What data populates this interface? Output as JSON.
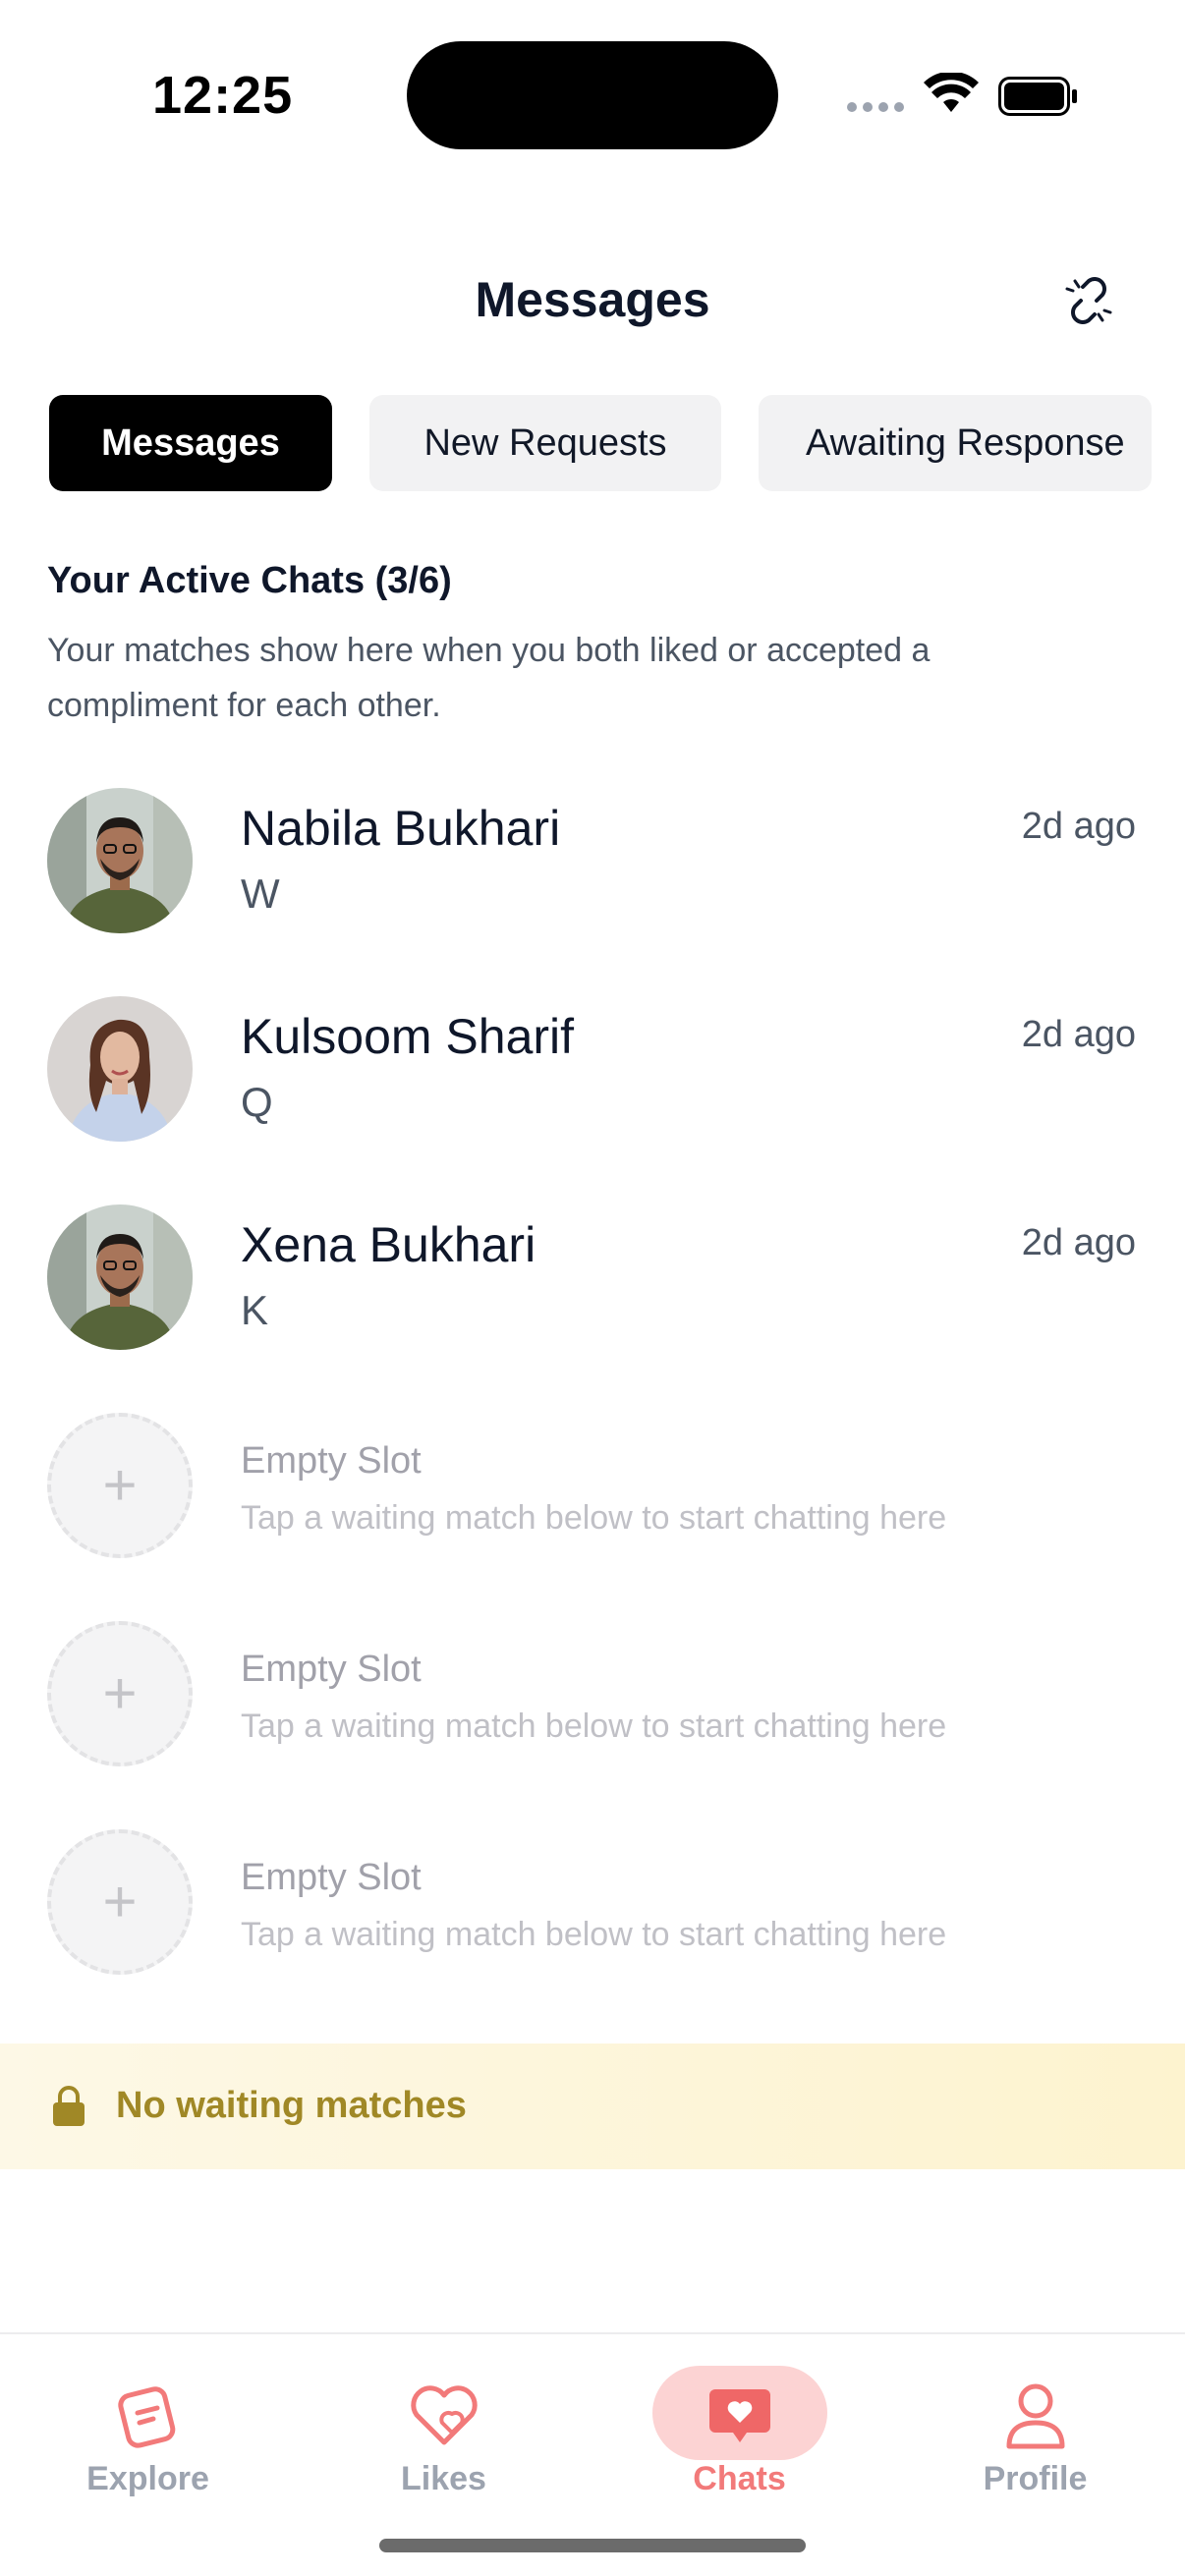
{
  "status_bar": {
    "time": "12:25"
  },
  "header": {
    "title": "Messages"
  },
  "tabs": [
    {
      "label": "Messages",
      "active": true
    },
    {
      "label": "New Requests",
      "active": false
    },
    {
      "label": "Awaiting Response",
      "active": false
    }
  ],
  "section": {
    "title": "Your Active Chats (3/6)",
    "description": "Your matches show here when you both liked or accepted a compliment for each other."
  },
  "chats": [
    {
      "name": "Nabila Bukhari",
      "message": "W",
      "time": "2d ago",
      "avatar": "man-photo"
    },
    {
      "name": "Kulsoom Sharif",
      "message": "Q",
      "time": "2d ago",
      "avatar": "woman-photo"
    },
    {
      "name": "Xena Bukhari",
      "message": "K",
      "time": "2d ago",
      "avatar": "man-photo"
    }
  ],
  "empty_slots": [
    {
      "title": "Empty Slot",
      "subtitle": "Tap a waiting match below to start chatting here"
    },
    {
      "title": "Empty Slot",
      "subtitle": "Tap a waiting match below to start chatting here"
    },
    {
      "title": "Empty Slot",
      "subtitle": "Tap a waiting match below to start chatting here"
    }
  ],
  "waiting_banner": {
    "text": "No waiting matches",
    "icon": "lock-icon"
  },
  "bottom_nav": [
    {
      "label": "Explore",
      "icon": "explore-icon",
      "active": false
    },
    {
      "label": "Likes",
      "icon": "likes-icon",
      "active": false
    },
    {
      "label": "Chats",
      "icon": "chats-icon",
      "active": true
    },
    {
      "label": "Profile",
      "icon": "profile-icon",
      "active": false
    }
  ],
  "colors": {
    "accent": "#f27a7a",
    "active_pill": "#fcd3d3",
    "banner_text": "#a08826",
    "tab_active_bg": "#000000",
    "tab_inactive_bg": "#f2f2f3"
  }
}
